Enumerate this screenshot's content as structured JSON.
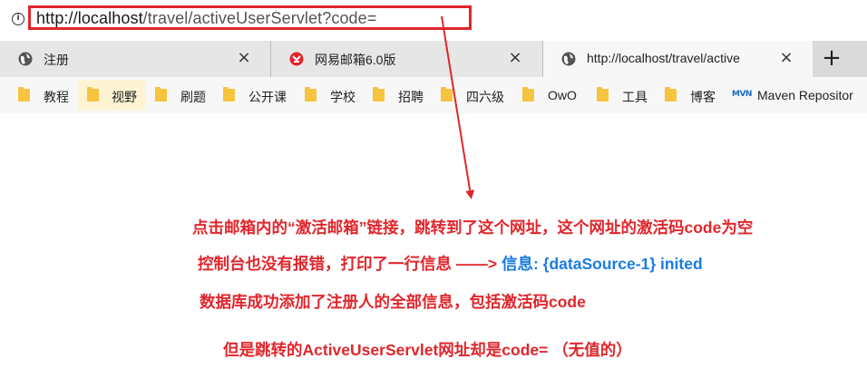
{
  "address_bar": {
    "url_host": "http://localhost",
    "url_path": "/travel/activeUserServlet?code="
  },
  "tabs": [
    {
      "title": "注册",
      "icon": "globe-icon",
      "close": "×"
    },
    {
      "title": "网易邮箱6.0版",
      "icon": "netease-mail-icon",
      "close": "×"
    },
    {
      "title": "http://localhost/travel/active",
      "icon": "globe-icon",
      "close": "×",
      "active": true
    }
  ],
  "new_tab_label": "+",
  "bookmarks": [
    {
      "label": "教程",
      "icon": "folder-icon"
    },
    {
      "label": "视野",
      "icon": "folder-icon"
    },
    {
      "label": "刷题",
      "icon": "folder-icon"
    },
    {
      "label": "公开课",
      "icon": "folder-icon"
    },
    {
      "label": "学校",
      "icon": "folder-icon"
    },
    {
      "label": "招聘",
      "icon": "folder-icon"
    },
    {
      "label": "四六级",
      "icon": "folder-icon"
    },
    {
      "label": "OwO",
      "icon": "folder-icon"
    },
    {
      "label": "工具",
      "icon": "folder-icon"
    },
    {
      "label": "博客",
      "icon": "folder-icon"
    },
    {
      "label": "Maven Repositor",
      "icon": "maven-icon",
      "icon_text": "MVN"
    }
  ],
  "annotations": {
    "line1": "点击邮箱内的“激活邮箱”链接，跳转到了这个网址，这个网址的激活码code为空",
    "line2_red": "控制台也没有报错，打印了一行信息 ——>",
    "line2_blue": " 信息: {dataSource-1} inited",
    "line3": "数据库成功添加了注册人的全部信息，包括激活码code",
    "line4": "但是跳转的ActiveUserServlet网址却是code= （无值的）"
  },
  "colors": {
    "annotation_red": "#e0262c",
    "annotation_blue": "#1a7ce2",
    "highlight_box": "#e0262c"
  }
}
